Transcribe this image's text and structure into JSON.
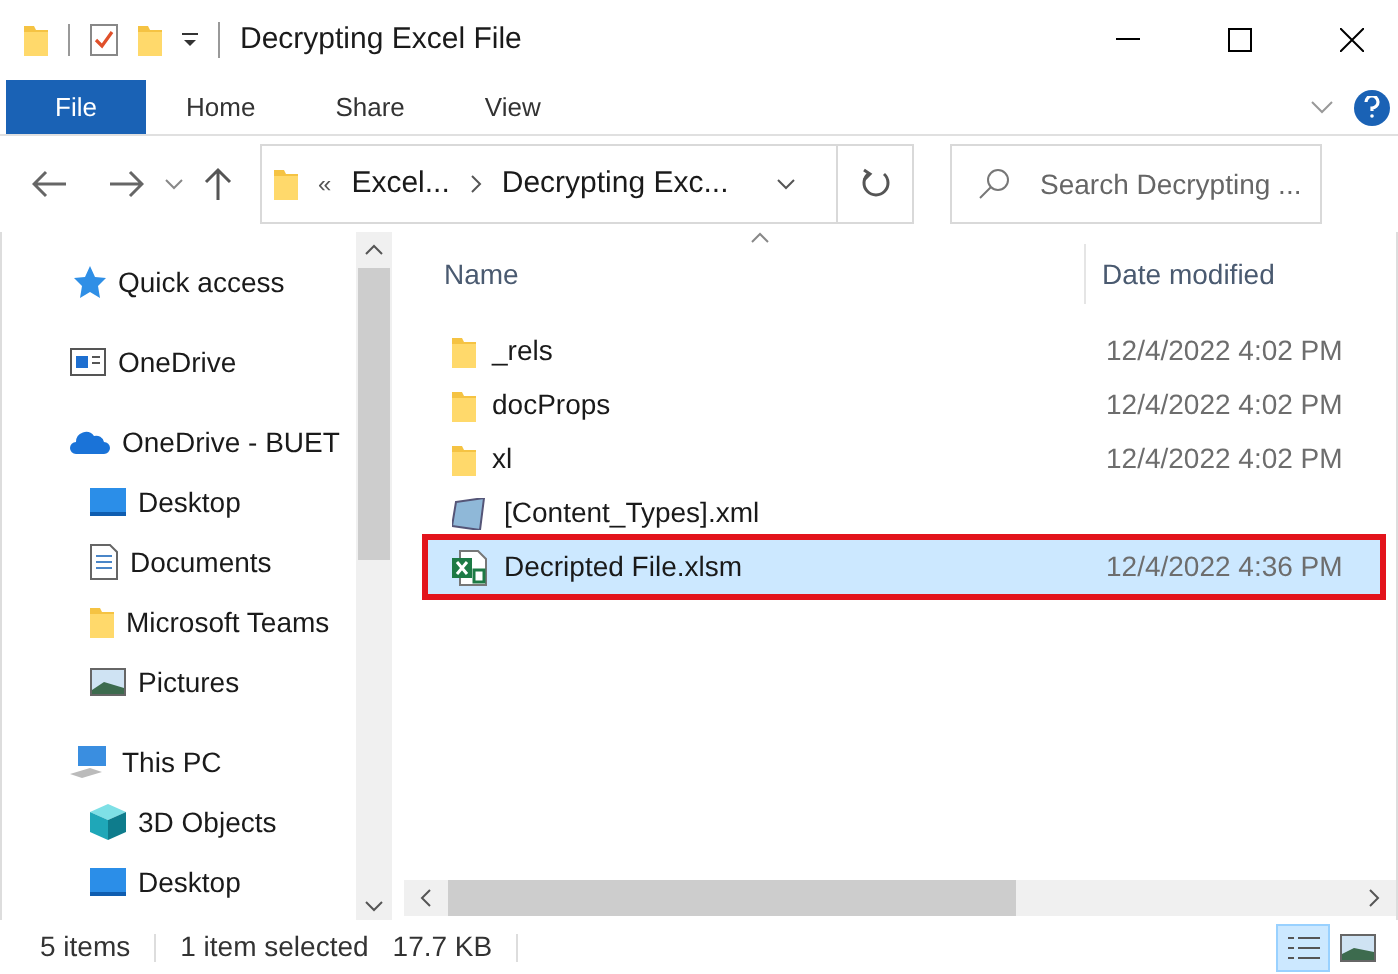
{
  "window": {
    "title": "Decrypting Excel File"
  },
  "ribbon_tabs": [
    {
      "label": "File",
      "selected": true
    },
    {
      "label": "Home",
      "selected": false
    },
    {
      "label": "Share",
      "selected": false
    },
    {
      "label": "View",
      "selected": false
    }
  ],
  "address_bar": {
    "overflow": "«",
    "crumbs": [
      "Excel...",
      "Decrypting Exc..."
    ]
  },
  "search": {
    "placeholder": "Search Decrypting ..."
  },
  "sidebar": {
    "items": [
      {
        "label": "Quick access",
        "kind": "star"
      },
      {
        "label": "OneDrive",
        "kind": "onedrive"
      },
      {
        "label": "OneDrive - BUET",
        "kind": "cloud",
        "children": [
          {
            "label": "Desktop",
            "kind": "desktop"
          },
          {
            "label": "Documents",
            "kind": "documents"
          },
          {
            "label": "Microsoft Teams",
            "kind": "folder"
          },
          {
            "label": "Pictures",
            "kind": "pictures"
          }
        ]
      },
      {
        "label": "This PC",
        "kind": "pc",
        "children": [
          {
            "label": "3D Objects",
            "kind": "cube"
          },
          {
            "label": "Desktop",
            "kind": "desktop"
          }
        ]
      }
    ]
  },
  "table": {
    "columns": [
      "Name",
      "Date modified"
    ],
    "rows": [
      {
        "name": "_rels",
        "date": "12/4/2022 4:02 PM",
        "kind": "folder",
        "selected": false,
        "highlighted": false
      },
      {
        "name": "docProps",
        "date": "12/4/2022 4:02 PM",
        "kind": "folder",
        "selected": false,
        "highlighted": false
      },
      {
        "name": "xl",
        "date": "12/4/2022 4:02 PM",
        "kind": "folder",
        "selected": false,
        "highlighted": false
      },
      {
        "name": "[Content_Types].xml",
        "kind": "xml",
        "selected": false,
        "highlighted": false
      },
      {
        "name": "Decripted File.xlsm",
        "date": "12/4/2022 4:36 PM",
        "kind": "excel",
        "selected": true,
        "highlighted": true
      }
    ]
  },
  "status_bar": {
    "count": "5 items",
    "selection": "1 item selected",
    "size": "17.7 KB"
  }
}
